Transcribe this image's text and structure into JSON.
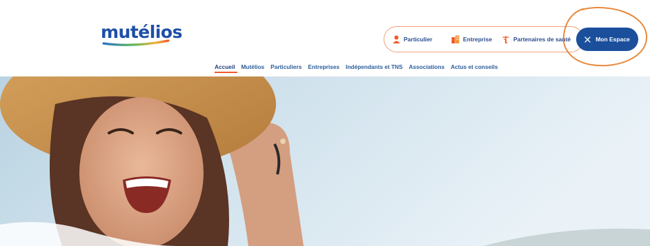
{
  "header": {
    "logo_text": "mutélios",
    "audience": [
      {
        "label": "Particulier",
        "icon": "person-icon"
      },
      {
        "label": "Entreprise",
        "icon": "building-icon"
      },
      {
        "label": "Partenaires de santé",
        "icon": "caduceus-icon"
      }
    ],
    "mon_espace_label": "Mon Espace"
  },
  "nav": {
    "items": [
      "Accueil",
      "Mutélios",
      "Particuliers",
      "Entreprises",
      "Indépendants et TNS",
      "Associations",
      "Actus et conseils"
    ],
    "active": "Accueil"
  },
  "colors": {
    "brand_blue": "#1f4fa8",
    "button_blue": "#1b4f9c",
    "accent_orange": "#f05a28",
    "highlight_orange": "#e8893a"
  }
}
